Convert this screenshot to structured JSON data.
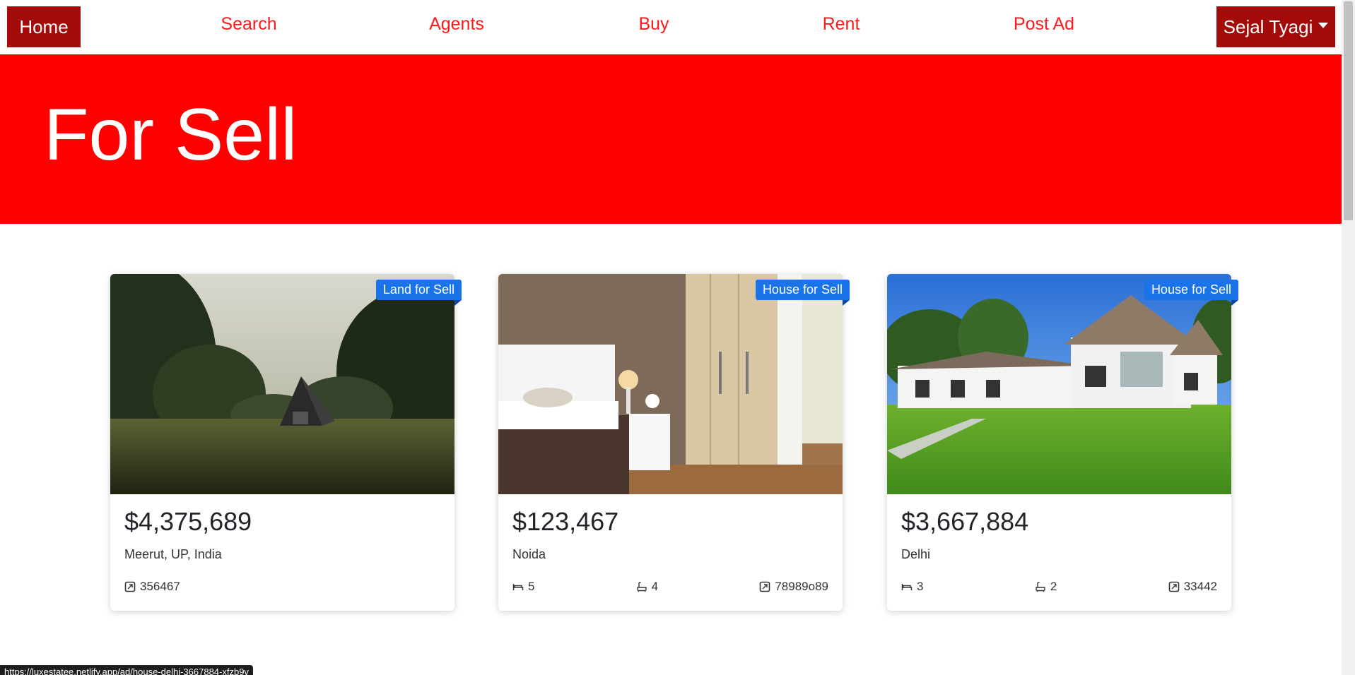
{
  "nav": {
    "home": "Home",
    "links": [
      "Search",
      "Agents",
      "Buy",
      "Rent",
      "Post Ad"
    ],
    "user": "Sejal Tyagi"
  },
  "hero": {
    "title": "For Sell"
  },
  "colors": {
    "brand_dark": "#a30b0b",
    "hero_red": "#ff0000",
    "nav_link_red": "#ff1a1a",
    "badge_blue": "#1a73e8"
  },
  "listings": [
    {
      "badge": "Land for Sell",
      "price": "$4,375,689",
      "location": "Meerut, UP, India",
      "image": "a-frame-cabin-in-forest",
      "area": "356467"
    },
    {
      "badge": "House for Sell",
      "price": "$123,467",
      "location": "Noida",
      "image": "bedroom-interior",
      "beds": "5",
      "baths": "4",
      "area": "78989o89"
    },
    {
      "badge": "House for Sell",
      "price": "$3,667,884",
      "location": "Delhi",
      "image": "white-house-with-lawn",
      "beds": "3",
      "baths": "2",
      "area": "33442"
    }
  ],
  "statusbar": {
    "url": "https://luxestatee.netlify.app/ad/house-delhi-3667884-xfzb9v"
  }
}
